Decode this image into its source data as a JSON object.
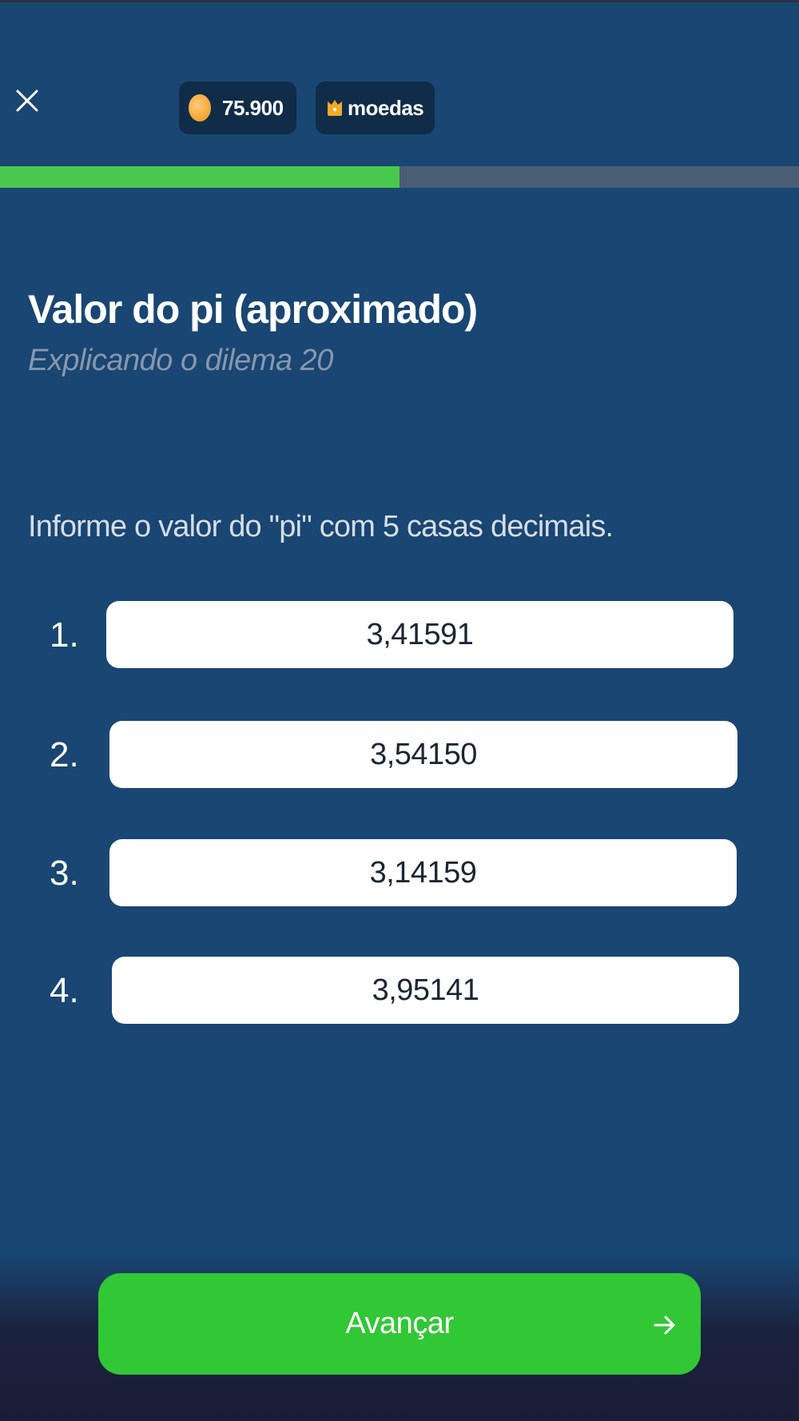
{
  "header": {
    "close_icon": "close-icon",
    "coins": {
      "icon": "coin-icon",
      "value": "75.900"
    },
    "currency": {
      "icon": "crown-icon",
      "label": "moedas"
    }
  },
  "progress": {
    "fraction": 0.5
  },
  "lesson": {
    "title": "Valor do pi (aproximado)",
    "subtitle": "Explicando o dilema 20"
  },
  "question": {
    "text": "Informe o valor do \"pi\" com 5 casas decimais.",
    "options": [
      {
        "number": "1.",
        "value": "3,41591"
      },
      {
        "number": "2.",
        "value": "3,54150"
      },
      {
        "number": "3.",
        "value": "3,14159"
      },
      {
        "number": "4.",
        "value": "3,95141"
      }
    ]
  },
  "footer": {
    "next_label": "Avançar",
    "next_icon": "arrow-right-icon"
  },
  "colors": {
    "background": "#194672",
    "progress_fill": "#48c94d",
    "progress_track": "#4b5d74",
    "primary_button": "#31c735",
    "pill_background": "#102c49",
    "coin": "#f6a93b"
  }
}
